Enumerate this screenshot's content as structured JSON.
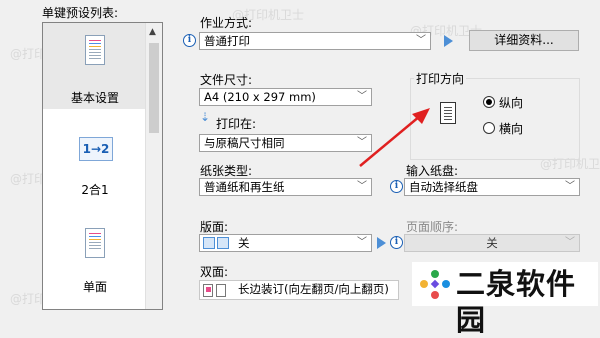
{
  "presets": {
    "title": "单键预设列表:",
    "items": [
      {
        "label": "基本设置",
        "icon": "document-icon"
      },
      {
        "label": "2合1",
        "icon_text": "1→2"
      },
      {
        "label": "单面",
        "icon": "document-icon"
      }
    ]
  },
  "job_mode": {
    "label": "作业方式:",
    "value": "普通打印",
    "details_button": "详细资料..."
  },
  "paper_size": {
    "label": "文件尺寸:",
    "value": "A4 (210 x 297 mm)"
  },
  "print_on": {
    "label": "打印在:",
    "value": "与原稿尺寸相同"
  },
  "paper_type": {
    "label": "纸张类型:",
    "value": "普通纸和再生纸"
  },
  "orientation": {
    "label": "打印方向",
    "portrait": "纵向",
    "landscape": "横向",
    "selected": "portrait"
  },
  "input_tray": {
    "label": "输入纸盘:",
    "value": "自动选择纸盘"
  },
  "layout": {
    "label": "版面:",
    "value": "关"
  },
  "page_order": {
    "label": "页面顺序:",
    "value": "关"
  },
  "duplex": {
    "label": "双面:",
    "value": "长边装订(向左翻页/向上翻页)"
  },
  "watermark": {
    "text": "@打印机卫士"
  },
  "brand": {
    "text": "二泉软件园"
  },
  "colors": {
    "arrow": "#e02020",
    "accent": "#1a5fb4"
  }
}
